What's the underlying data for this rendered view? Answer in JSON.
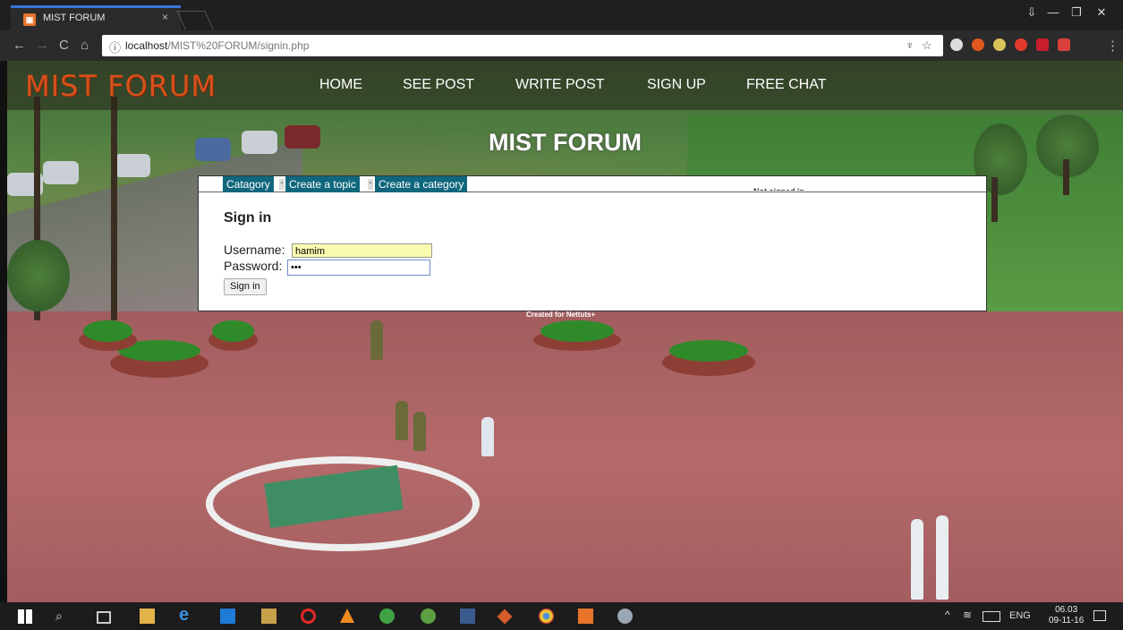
{
  "browser": {
    "tab_title": "MIST FORUM",
    "tab_close": "×",
    "url_host": "localhost",
    "url_path": "/MIST%20FORUM/signin.php",
    "window_buttons": [
      "⇩",
      "—",
      "❐",
      "✕"
    ],
    "nav": {
      "back": "←",
      "forward": "→",
      "reload": "C",
      "home": "⌂"
    }
  },
  "site": {
    "logo": "MIST FORUM",
    "menu": [
      "HOME",
      "SEE POST",
      "WRITE POST",
      "SIGN UP",
      "FREE CHAT"
    ],
    "title": "MIST FORUM",
    "userbar_text": "Not signed in",
    "tabs": [
      "Catagory",
      "Create a topic",
      "Create a category"
    ],
    "separator": "-",
    "signin": {
      "heading": "Sign in",
      "username_label": "Username:",
      "username_value": "hamim",
      "password_label": "Password:",
      "password_value": "•••",
      "button": "Sign in"
    },
    "credit": "Created for Nettuts+"
  },
  "taskbar": {
    "tray_language": "ENG",
    "clock_time": "06.03",
    "clock_date": "09-11-16"
  },
  "colors": {
    "logo": "#d8501b",
    "tab_button": "#10677d",
    "username_bg": "#fafbb0"
  }
}
